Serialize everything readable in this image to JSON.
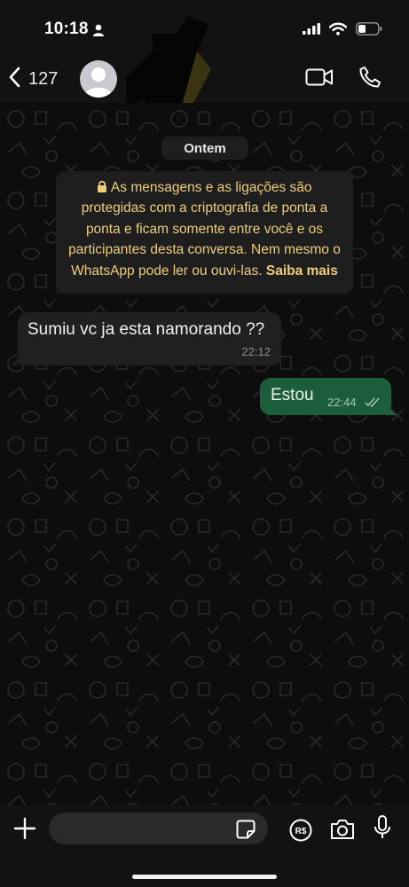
{
  "status_bar": {
    "time": "10:18"
  },
  "header": {
    "back_count": "127"
  },
  "chat": {
    "date_label": "Ontem",
    "encryption_notice": {
      "text": "As mensagens e as ligações são protegidas com a criptografia de ponta a ponta e ficam somente entre você e os participantes desta conversa. Nem mesmo o WhatsApp pode ler ou ouvi-las.",
      "link": "Saiba mais"
    },
    "messages": [
      {
        "direction": "incoming",
        "text": "Sumiu vc ja esta namorando ??",
        "time": "22:12"
      },
      {
        "direction": "outgoing",
        "text": "Estou",
        "time": "22:44",
        "status": "read"
      }
    ]
  },
  "input": {
    "placeholder": "",
    "value": ""
  },
  "icons": {
    "status": [
      "person-icon",
      "signal-icon",
      "wifi-icon",
      "battery-icon"
    ],
    "header": [
      "back-chevron-icon",
      "avatar",
      "video-call-icon",
      "phone-icon"
    ],
    "composer": [
      "plus-icon",
      "sticker-icon",
      "payment-icon",
      "camera-icon",
      "microphone-icon"
    ]
  },
  "colors": {
    "background": "#0b0b0b",
    "bars": "#121212",
    "incoming_bubble": "#202020",
    "outgoing_bubble": "#1c5d3b",
    "system_chip": "#1e1e1e",
    "notice_text": "#efce7a"
  }
}
